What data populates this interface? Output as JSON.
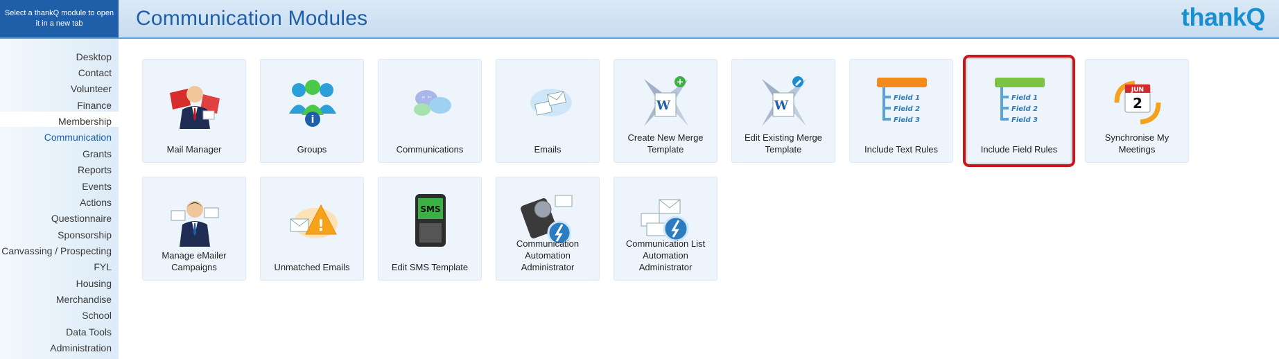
{
  "header": {
    "note": "Select a thankQ module to open it in a new tab",
    "title": "Communication Modules",
    "logo": "thankQ"
  },
  "sidebar": {
    "items": [
      {
        "label": "Desktop",
        "active": false
      },
      {
        "label": "Contact",
        "active": false
      },
      {
        "label": "Volunteer",
        "active": false
      },
      {
        "label": "Finance",
        "active": false
      },
      {
        "label": "Membership",
        "active": false
      },
      {
        "label": "Communication",
        "active": true
      },
      {
        "label": "Grants",
        "active": false
      },
      {
        "label": "Reports",
        "active": false
      },
      {
        "label": "Events",
        "active": false
      },
      {
        "label": "Actions",
        "active": false
      },
      {
        "label": "Questionnaire",
        "active": false
      },
      {
        "label": "Sponsorship",
        "active": false
      },
      {
        "label": "Canvassing / Prospecting",
        "active": false
      },
      {
        "label": "FYL",
        "active": false
      },
      {
        "label": "Housing",
        "active": false
      },
      {
        "label": "Merchandise",
        "active": false
      },
      {
        "label": "School",
        "active": false
      },
      {
        "label": "Data Tools",
        "active": false
      },
      {
        "label": "Administration",
        "active": false
      }
    ]
  },
  "modules": [
    {
      "label": "Mail Manager",
      "icon": "mail-manager-icon",
      "selected": false
    },
    {
      "label": "Groups",
      "icon": "groups-icon",
      "selected": false
    },
    {
      "label": "Communications",
      "icon": "communications-icon",
      "selected": false
    },
    {
      "label": "Emails",
      "icon": "emails-icon",
      "selected": false
    },
    {
      "label": "Create New Merge Template",
      "icon": "create-merge-template-icon",
      "selected": false
    },
    {
      "label": "Edit Existing Merge Template",
      "icon": "edit-merge-template-icon",
      "selected": false
    },
    {
      "label": "Include Text Rules",
      "icon": "include-text-rules-icon",
      "selected": false
    },
    {
      "label": "Include Field Rules",
      "icon": "include-field-rules-icon",
      "selected": true
    },
    {
      "label": "Synchronise My Meetings",
      "icon": "calendar-sync-icon",
      "selected": false
    },
    {
      "label": "Manage eMailer Campaigns",
      "icon": "emailer-campaigns-icon",
      "selected": false
    },
    {
      "label": "Unmatched Emails",
      "icon": "unmatched-emails-icon",
      "selected": false
    },
    {
      "label": "Edit SMS Template",
      "icon": "sms-phone-icon",
      "selected": false
    },
    {
      "label": "Communication Automation Administrator",
      "icon": "automation-admin-icon",
      "selected": false
    },
    {
      "label": "Communication List Automation Administrator",
      "icon": "list-automation-icon",
      "selected": false
    }
  ],
  "icon_text": {
    "field1": "Field 1",
    "field2": "Field 2",
    "field3": "Field 3",
    "sms": "SMS",
    "jun": "JUN",
    "day": "2",
    "word": "W"
  },
  "colors": {
    "accent": "#1f5ea8",
    "logo": "#1a8fd0",
    "selection": "#c8161d"
  }
}
